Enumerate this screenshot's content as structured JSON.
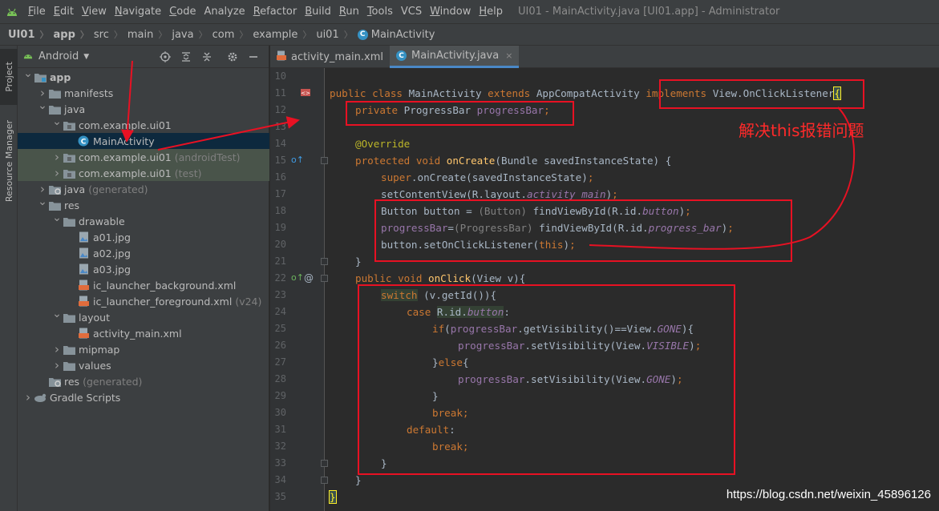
{
  "app": {
    "window_title": "UI01 - MainActivity.java [UI01.app] - Administrator",
    "logo_icon": "android-icon"
  },
  "menu": [
    {
      "mnemonic": "F",
      "rest": "ile"
    },
    {
      "mnemonic": "E",
      "rest": "dit"
    },
    {
      "mnemonic": "V",
      "rest": "iew"
    },
    {
      "mnemonic": "N",
      "rest": "avigate"
    },
    {
      "mnemonic": "C",
      "rest": "ode"
    },
    {
      "mnemonic": "",
      "rest": "Analyze"
    },
    {
      "mnemonic": "R",
      "rest": "efactor"
    },
    {
      "mnemonic": "B",
      "rest": "uild"
    },
    {
      "mnemonic": "R",
      "rest": "un"
    },
    {
      "mnemonic": "T",
      "rest": "ools"
    },
    {
      "mnemonic": "",
      "rest": "VCS"
    },
    {
      "mnemonic": "W",
      "rest": "indow"
    },
    {
      "mnemonic": "H",
      "rest": "elp"
    }
  ],
  "breadcrumb": [
    "UI01",
    "app",
    "src",
    "main",
    "java",
    "com",
    "example",
    "ui01",
    "MainActivity"
  ],
  "tool_stripe": {
    "project": "Project",
    "resource_manager": "Resource Manager"
  },
  "project_panel": {
    "view_selector": "Android",
    "tools": [
      "locate-icon",
      "expand-all-icon",
      "collapse-all-icon",
      "gear-icon",
      "minimize-icon"
    ]
  },
  "tree": [
    {
      "label": "app",
      "suffix": "",
      "icon": "module-folder-icon",
      "bold": true,
      "arrow": "down"
    },
    {
      "label": "manifests",
      "suffix": "",
      "icon": "folder-icon",
      "arrow": "right"
    },
    {
      "label": "java",
      "suffix": "",
      "icon": "folder-icon",
      "arrow": "down"
    },
    {
      "label": "com.example.ui01",
      "suffix": "",
      "icon": "package-icon",
      "arrow": "down"
    },
    {
      "label": "MainActivity",
      "suffix": "",
      "icon": "class-icon",
      "selected": true,
      "arrow": ""
    },
    {
      "label": "com.example.ui01",
      "suffix": "(androidTest)",
      "icon": "package-icon",
      "test": true,
      "arrow": "right"
    },
    {
      "label": "com.example.ui01",
      "suffix": "(test)",
      "icon": "package-icon",
      "test": true,
      "arrow": "right"
    },
    {
      "label": "java",
      "suffix": "(generated)",
      "icon": "generated-folder-icon",
      "arrow": "right"
    },
    {
      "label": "res",
      "suffix": "",
      "icon": "folder-icon",
      "arrow": "down"
    },
    {
      "label": "drawable",
      "suffix": "",
      "icon": "folder-icon",
      "arrow": "down"
    },
    {
      "label": "a01.jpg",
      "suffix": "",
      "icon": "image-file-icon",
      "arrow": ""
    },
    {
      "label": "a02.jpg",
      "suffix": "",
      "icon": "image-file-icon",
      "arrow": ""
    },
    {
      "label": "a03.jpg",
      "suffix": "",
      "icon": "image-file-icon",
      "arrow": ""
    },
    {
      "label": "ic_launcher_background.xml",
      "suffix": "",
      "icon": "xml-file-icon",
      "arrow": ""
    },
    {
      "label": "ic_launcher_foreground.xml",
      "suffix": "(v24)",
      "icon": "xml-file-icon",
      "arrow": ""
    },
    {
      "label": "layout",
      "suffix": "",
      "icon": "folder-icon",
      "arrow": "down"
    },
    {
      "label": "activity_main.xml",
      "suffix": "",
      "icon": "xml-file-icon",
      "arrow": ""
    },
    {
      "label": "mipmap",
      "suffix": "",
      "icon": "folder-icon",
      "arrow": "right"
    },
    {
      "label": "values",
      "suffix": "",
      "icon": "folder-icon",
      "arrow": "right"
    },
    {
      "label": "res",
      "suffix": "(generated)",
      "icon": "generated-folder-icon",
      "arrow": ""
    },
    {
      "label": "Gradle Scripts",
      "suffix": "",
      "icon": "gradle-icon",
      "arrow": "right"
    }
  ],
  "editor_tabs": [
    {
      "label": "activity_main.xml",
      "icon": "xml-file-icon",
      "active": false
    },
    {
      "label": "MainActivity.java",
      "icon": "class-icon",
      "active": true,
      "close": "×"
    }
  ],
  "code": {
    "line_numbers": [
      "10",
      "11",
      "12",
      "13",
      "14",
      "15",
      "16",
      "17",
      "18",
      "19",
      "20",
      "21",
      "22",
      "23",
      "24",
      "25",
      "26",
      "27",
      "28",
      "29",
      "30",
      "31",
      "32",
      "33",
      "34",
      "35"
    ],
    "l11": {
      "t1": "public class ",
      "t2": "MainActivity ",
      "t3": "extends ",
      "t4": "AppCompatActivity ",
      "t5": "implements ",
      "t6": "View.OnClickListener",
      "t7": "{"
    },
    "l12": {
      "t1": "private ",
      "t2": "ProgressBar ",
      "t3": "progressBar",
      "t4": ";"
    },
    "l14": {
      "t1": "@Override"
    },
    "l15": {
      "t1": "protected void ",
      "t2": "onCreate",
      "t3": "(Bundle savedInstanceState) {"
    },
    "l16": {
      "t1": "super",
      "t2": ".onCreate(savedInstanceState)",
      "t3": ";"
    },
    "l17": {
      "t1": "setContentView(R.layout.",
      "t2": "activity_main",
      "t3": ")",
      "t4": ";"
    },
    "l18": {
      "t1": "Button button = ",
      "t2": "(Button) ",
      "t3": "findViewById(R.id.",
      "t4": "button",
      "t5": ")",
      "t6": ";"
    },
    "l19": {
      "t1": "progressBar",
      "t2": "=",
      "t3": "(ProgressBar) ",
      "t4": "findViewById(R.id.",
      "t5": "progress_bar",
      "t6": ")",
      "t7": ";"
    },
    "l20": {
      "t1": "button.setOnClickListener(",
      "t2": "this",
      "t3": ")",
      "t4": ";"
    },
    "l21": {
      "t1": "}"
    },
    "l22": {
      "t1": "public void ",
      "t2": "onClick",
      "t3": "(View v){"
    },
    "l23": {
      "t1": "switch",
      "t2": " (v.getId()){"
    },
    "l24": {
      "t1": "case ",
      "t2": "R.id.",
      "t3": "button",
      "t4": ":"
    },
    "l25": {
      "t1": "if",
      "t2": "(",
      "t3": "progressBar",
      "t4": ".getVisibility()==View.",
      "t5": "GONE",
      "t6": "){"
    },
    "l26": {
      "t1": "progressBar",
      "t2": ".setVisibility(View.",
      "t3": "VISIBLE",
      "t4": ")",
      "t5": ";"
    },
    "l27": {
      "t1": "}",
      "t2": "else",
      "t3": "{"
    },
    "l28": {
      "t1": "progressBar",
      "t2": ".setVisibility(View.",
      "t3": "GONE",
      "t4": ")",
      "t5": ";"
    },
    "l29": {
      "t1": "}"
    },
    "l30": {
      "t1": "break;"
    },
    "l31": {
      "t1": "default",
      "t2": ":"
    },
    "l32": {
      "t1": "break;"
    },
    "l33": {
      "t1": "}"
    },
    "l34": {
      "t1": "}"
    },
    "l35": {
      "t1": "}"
    }
  },
  "annotation": {
    "note": "解决this报错问题",
    "watermark": "https://blog.csdn.net/weixin_45896126",
    "color": "#e81123"
  },
  "colors": {
    "keyword": "#cc7832",
    "method": "#ffc66d",
    "field": "#9876aa",
    "annotation": "#bbb529",
    "accent": "#4a88c7"
  }
}
